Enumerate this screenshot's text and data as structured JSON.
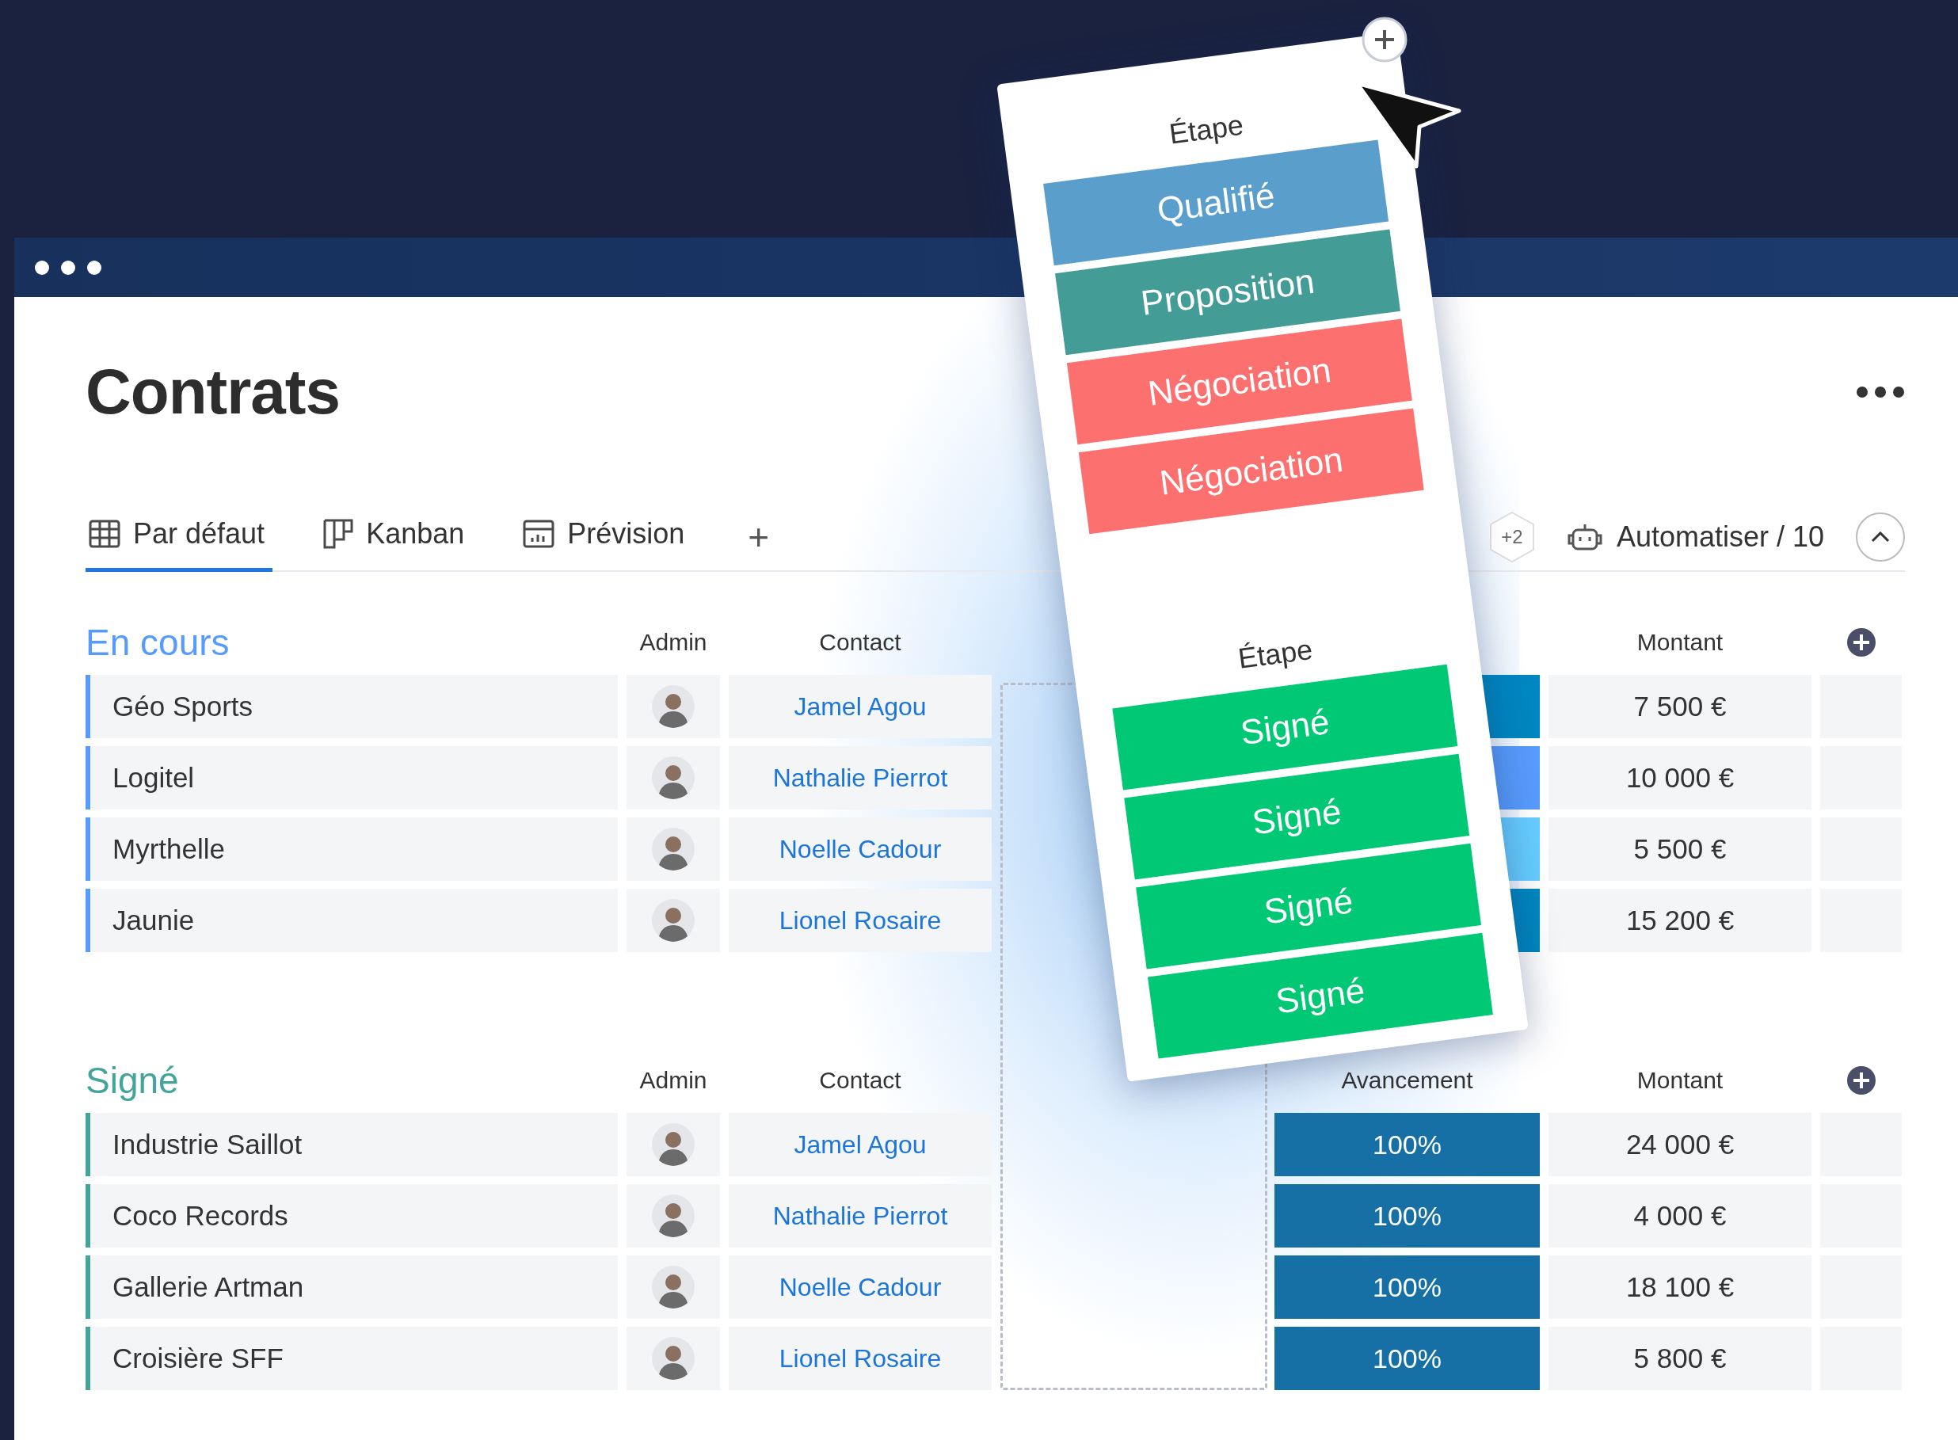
{
  "title": "Contrats",
  "tabs": [
    {
      "label": "Par défaut",
      "kind": "table",
      "selected": true
    },
    {
      "label": "Kanban",
      "kind": "kanban",
      "selected": false
    },
    {
      "label": "Prévision",
      "kind": "chart",
      "selected": false
    }
  ],
  "add_tab": "+",
  "toolbar": {
    "badge": "+2",
    "automate": "Automatiser / 10"
  },
  "groups": [
    {
      "title": "En cours",
      "color": "#579bfc",
      "columns": {
        "admin": "Admin",
        "contact": "Contact",
        "amount": "Montant"
      },
      "rows": [
        {
          "name": "Géo Sports",
          "contact": "Jamel Agou",
          "color": "#0086c0",
          "amount": "7 500 €"
        },
        {
          "name": "Logitel",
          "contact": "Nathalie Pierrot",
          "color": "#579bfc",
          "amount": "10 000 €"
        },
        {
          "name": "Myrthelle",
          "contact": "Noelle Cadour",
          "color": "#66ccff",
          "amount": "5 500 €"
        },
        {
          "name": "Jaunie",
          "contact": "Lionel Rosaire",
          "color": "#0086c0",
          "amount": "15 200 €"
        }
      ]
    },
    {
      "title": "Signé",
      "color": "#43a59a",
      "columns": {
        "admin": "Admin",
        "contact": "Contact",
        "progress": "Avancement",
        "amount": "Montant"
      },
      "rows": [
        {
          "name": "Industrie Saillot",
          "contact": "Jamel Agou",
          "color": "#1670a5",
          "progress": "100%",
          "amount": "24 000 €"
        },
        {
          "name": "Coco Records",
          "contact": "Nathalie Pierrot",
          "color": "#1670a5",
          "progress": "100%",
          "amount": "4 000 €"
        },
        {
          "name": "Gallerie Artman",
          "contact": "Noelle Cadour",
          "color": "#1670a5",
          "progress": "100%",
          "amount": "18 100 €"
        },
        {
          "name": "Croisière SFF",
          "contact": "Lionel Rosaire",
          "color": "#1670a5",
          "progress": "100%",
          "amount": "5 800 €"
        }
      ]
    }
  ],
  "card": {
    "sections": [
      {
        "title": "Étape",
        "labels": [
          {
            "text": "Qualifié",
            "color": "#5a9fcb"
          },
          {
            "text": "Proposition",
            "color": "#449c96"
          },
          {
            "text": "Négociation",
            "color": "#fc7070"
          },
          {
            "text": "Négociation",
            "color": "#fc7070"
          }
        ]
      },
      {
        "title": "Étape",
        "labels": [
          {
            "text": "Signé",
            "color": "#00c875"
          },
          {
            "text": "Signé",
            "color": "#00c875"
          },
          {
            "text": "Signé",
            "color": "#00c875"
          },
          {
            "text": "Signé",
            "color": "#00c875"
          }
        ]
      }
    ]
  }
}
